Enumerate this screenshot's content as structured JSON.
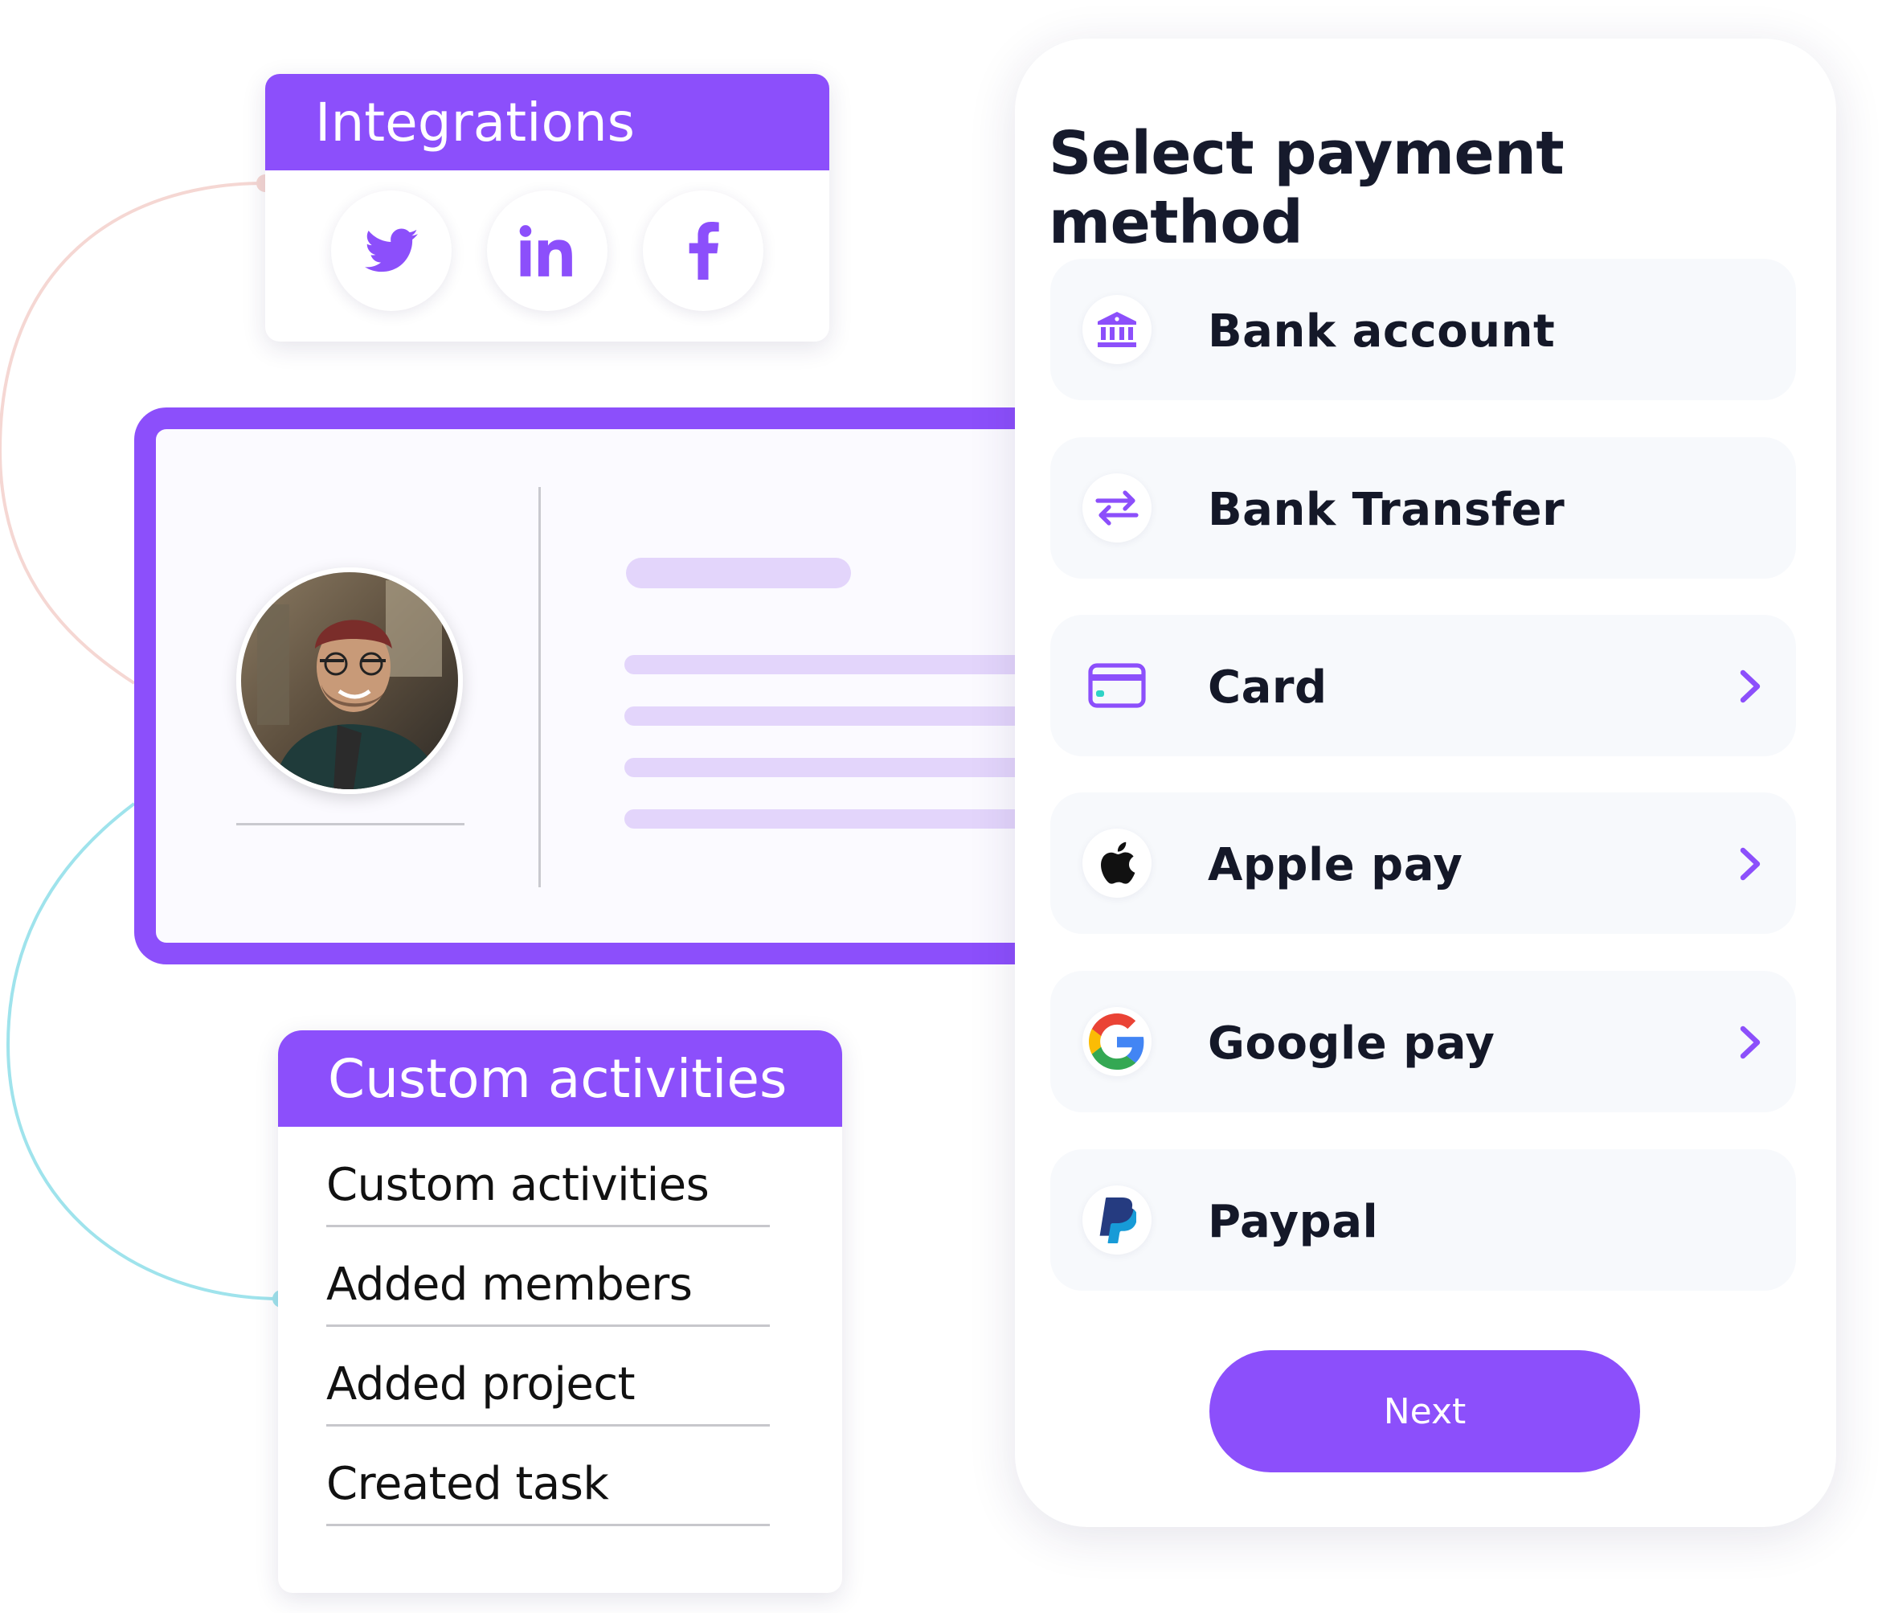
{
  "integrations": {
    "title": "Integrations",
    "icons": [
      "twitter-icon",
      "linkedin-icon",
      "facebook-icon"
    ]
  },
  "activities": {
    "title": "Custom activities",
    "items": [
      "Custom activities",
      "Added members",
      "Added project",
      "Created task"
    ]
  },
  "payment": {
    "title": "Select payment method",
    "options": [
      {
        "label": "Bank account",
        "icon": "bank-icon",
        "chevron": false
      },
      {
        "label": "Bank Transfer",
        "icon": "transfer-icon",
        "chevron": false
      },
      {
        "label": "Card",
        "icon": "card-icon",
        "chevron": true
      },
      {
        "label": "Apple pay",
        "icon": "apple-icon",
        "chevron": true
      },
      {
        "label": "Google pay",
        "icon": "google-icon",
        "chevron": true
      },
      {
        "label": "Paypal",
        "icon": "paypal-icon",
        "chevron": false
      }
    ],
    "next_label": "Next"
  },
  "colors": {
    "accent": "#8c4ffb",
    "skeleton": "#e3d5fb",
    "option_bg": "#f7f9fc",
    "connector_pink": "#f5d7d3",
    "connector_cyan": "#9fe3ec"
  }
}
